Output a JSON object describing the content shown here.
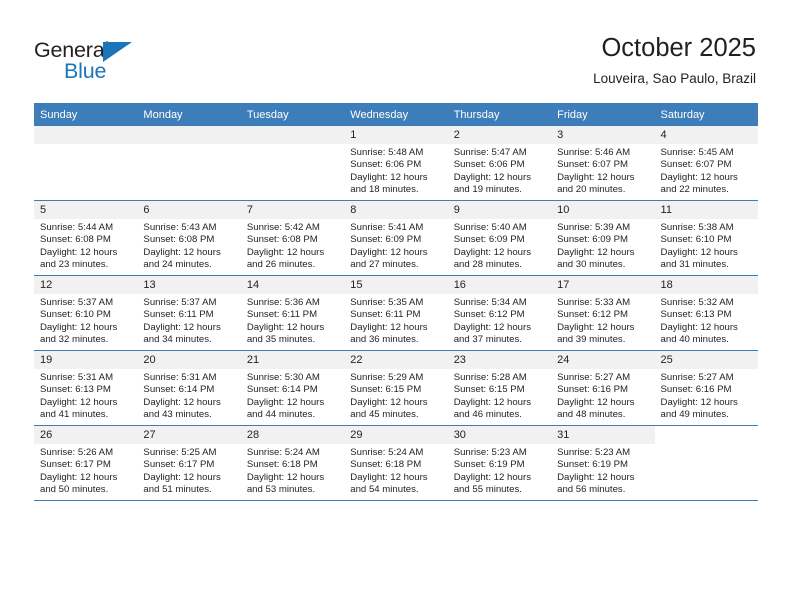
{
  "brand": {
    "name_part1": "General",
    "name_part2": "Blue",
    "accent_color": "#1b75bb"
  },
  "header": {
    "title": "October 2025",
    "subtitle": "Louveira, Sao Paulo, Brazil"
  },
  "theme": {
    "header_row_color": "#3d7dba",
    "day_band_color": "#f1f1f1",
    "text_color": "#231f20"
  },
  "weekday_headers": [
    "Sunday",
    "Monday",
    "Tuesday",
    "Wednesday",
    "Thursday",
    "Friday",
    "Saturday"
  ],
  "weeks": [
    [
      {
        "day": "",
        "blank": true,
        "lines": []
      },
      {
        "day": "",
        "blank": true,
        "lines": []
      },
      {
        "day": "",
        "blank": true,
        "lines": []
      },
      {
        "day": "1",
        "lines": [
          "Sunrise: 5:48 AM",
          "Sunset: 6:06 PM",
          "Daylight: 12 hours",
          "and 18 minutes."
        ]
      },
      {
        "day": "2",
        "lines": [
          "Sunrise: 5:47 AM",
          "Sunset: 6:06 PM",
          "Daylight: 12 hours",
          "and 19 minutes."
        ]
      },
      {
        "day": "3",
        "lines": [
          "Sunrise: 5:46 AM",
          "Sunset: 6:07 PM",
          "Daylight: 12 hours",
          "and 20 minutes."
        ]
      },
      {
        "day": "4",
        "lines": [
          "Sunrise: 5:45 AM",
          "Sunset: 6:07 PM",
          "Daylight: 12 hours",
          "and 22 minutes."
        ]
      }
    ],
    [
      {
        "day": "5",
        "lines": [
          "Sunrise: 5:44 AM",
          "Sunset: 6:08 PM",
          "Daylight: 12 hours",
          "and 23 minutes."
        ]
      },
      {
        "day": "6",
        "lines": [
          "Sunrise: 5:43 AM",
          "Sunset: 6:08 PM",
          "Daylight: 12 hours",
          "and 24 minutes."
        ]
      },
      {
        "day": "7",
        "lines": [
          "Sunrise: 5:42 AM",
          "Sunset: 6:08 PM",
          "Daylight: 12 hours",
          "and 26 minutes."
        ]
      },
      {
        "day": "8",
        "lines": [
          "Sunrise: 5:41 AM",
          "Sunset: 6:09 PM",
          "Daylight: 12 hours",
          "and 27 minutes."
        ]
      },
      {
        "day": "9",
        "lines": [
          "Sunrise: 5:40 AM",
          "Sunset: 6:09 PM",
          "Daylight: 12 hours",
          "and 28 minutes."
        ]
      },
      {
        "day": "10",
        "lines": [
          "Sunrise: 5:39 AM",
          "Sunset: 6:09 PM",
          "Daylight: 12 hours",
          "and 30 minutes."
        ]
      },
      {
        "day": "11",
        "lines": [
          "Sunrise: 5:38 AM",
          "Sunset: 6:10 PM",
          "Daylight: 12 hours",
          "and 31 minutes."
        ]
      }
    ],
    [
      {
        "day": "12",
        "lines": [
          "Sunrise: 5:37 AM",
          "Sunset: 6:10 PM",
          "Daylight: 12 hours",
          "and 32 minutes."
        ]
      },
      {
        "day": "13",
        "lines": [
          "Sunrise: 5:37 AM",
          "Sunset: 6:11 PM",
          "Daylight: 12 hours",
          "and 34 minutes."
        ]
      },
      {
        "day": "14",
        "lines": [
          "Sunrise: 5:36 AM",
          "Sunset: 6:11 PM",
          "Daylight: 12 hours",
          "and 35 minutes."
        ]
      },
      {
        "day": "15",
        "lines": [
          "Sunrise: 5:35 AM",
          "Sunset: 6:11 PM",
          "Daylight: 12 hours",
          "and 36 minutes."
        ]
      },
      {
        "day": "16",
        "lines": [
          "Sunrise: 5:34 AM",
          "Sunset: 6:12 PM",
          "Daylight: 12 hours",
          "and 37 minutes."
        ]
      },
      {
        "day": "17",
        "lines": [
          "Sunrise: 5:33 AM",
          "Sunset: 6:12 PM",
          "Daylight: 12 hours",
          "and 39 minutes."
        ]
      },
      {
        "day": "18",
        "lines": [
          "Sunrise: 5:32 AM",
          "Sunset: 6:13 PM",
          "Daylight: 12 hours",
          "and 40 minutes."
        ]
      }
    ],
    [
      {
        "day": "19",
        "lines": [
          "Sunrise: 5:31 AM",
          "Sunset: 6:13 PM",
          "Daylight: 12 hours",
          "and 41 minutes."
        ]
      },
      {
        "day": "20",
        "lines": [
          "Sunrise: 5:31 AM",
          "Sunset: 6:14 PM",
          "Daylight: 12 hours",
          "and 43 minutes."
        ]
      },
      {
        "day": "21",
        "lines": [
          "Sunrise: 5:30 AM",
          "Sunset: 6:14 PM",
          "Daylight: 12 hours",
          "and 44 minutes."
        ]
      },
      {
        "day": "22",
        "lines": [
          "Sunrise: 5:29 AM",
          "Sunset: 6:15 PM",
          "Daylight: 12 hours",
          "and 45 minutes."
        ]
      },
      {
        "day": "23",
        "lines": [
          "Sunrise: 5:28 AM",
          "Sunset: 6:15 PM",
          "Daylight: 12 hours",
          "and 46 minutes."
        ]
      },
      {
        "day": "24",
        "lines": [
          "Sunrise: 5:27 AM",
          "Sunset: 6:16 PM",
          "Daylight: 12 hours",
          "and 48 minutes."
        ]
      },
      {
        "day": "25",
        "lines": [
          "Sunrise: 5:27 AM",
          "Sunset: 6:16 PM",
          "Daylight: 12 hours",
          "and 49 minutes."
        ]
      }
    ],
    [
      {
        "day": "26",
        "lines": [
          "Sunrise: 5:26 AM",
          "Sunset: 6:17 PM",
          "Daylight: 12 hours",
          "and 50 minutes."
        ]
      },
      {
        "day": "27",
        "lines": [
          "Sunrise: 5:25 AM",
          "Sunset: 6:17 PM",
          "Daylight: 12 hours",
          "and 51 minutes."
        ]
      },
      {
        "day": "28",
        "lines": [
          "Sunrise: 5:24 AM",
          "Sunset: 6:18 PM",
          "Daylight: 12 hours",
          "and 53 minutes."
        ]
      },
      {
        "day": "29",
        "lines": [
          "Sunrise: 5:24 AM",
          "Sunset: 6:18 PM",
          "Daylight: 12 hours",
          "and 54 minutes."
        ]
      },
      {
        "day": "30",
        "lines": [
          "Sunrise: 5:23 AM",
          "Sunset: 6:19 PM",
          "Daylight: 12 hours",
          "and 55 minutes."
        ]
      },
      {
        "day": "31",
        "lines": [
          "Sunrise: 5:23 AM",
          "Sunset: 6:19 PM",
          "Daylight: 12 hours",
          "and 56 minutes."
        ]
      },
      {
        "day": "",
        "trailing": true,
        "lines": []
      }
    ]
  ]
}
